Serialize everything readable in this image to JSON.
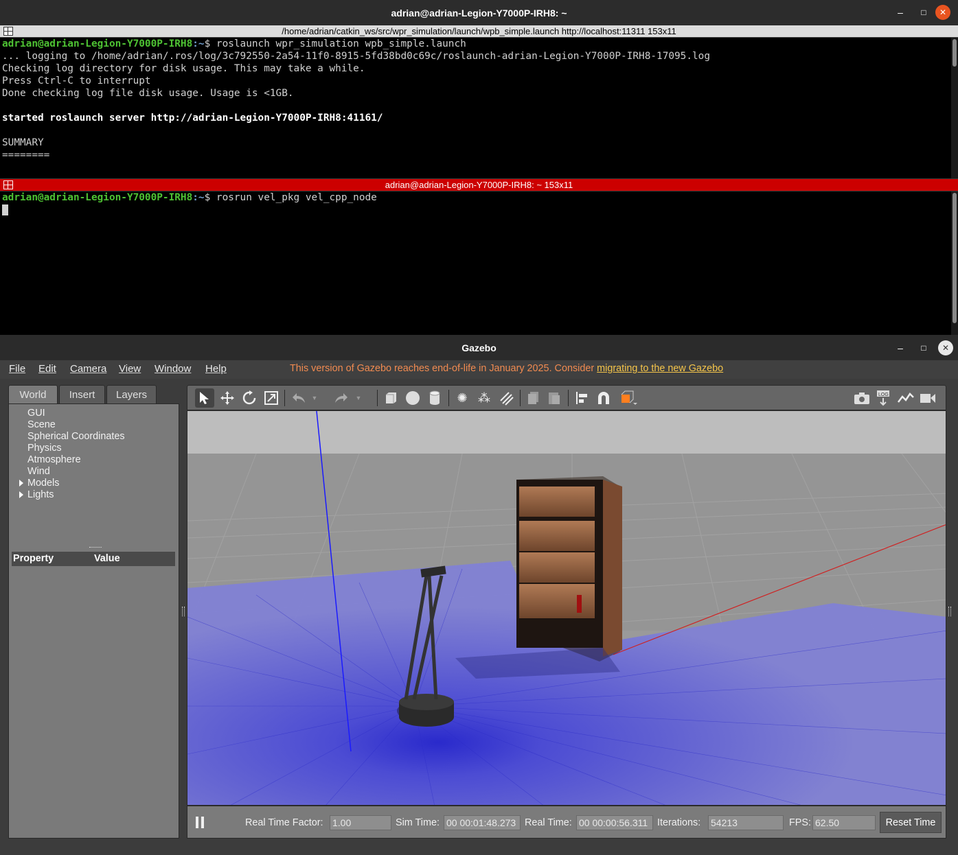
{
  "terminal": {
    "window_title": "adrian@adrian-Legion-Y7000P-IRH8: ~",
    "pane1_title": "/home/adrian/catkin_ws/src/wpr_simulation/launch/wpb_simple.launch http://localhost:11311 153x11",
    "pane2_title": "adrian@adrian-Legion-Y7000P-IRH8: ~ 153x11",
    "prompt_user": "adrian@adrian-Legion-Y7000P-IRH8",
    "prompt_path": ":~",
    "pane1_command": "$ roslaunch wpr_simulation wpb_simple.launch",
    "pane1_lines": [
      "... logging to /home/adrian/.ros/log/3c792550-2a54-11f0-8915-5fd38bd0c69c/roslaunch-adrian-Legion-Y7000P-IRH8-17095.log",
      "Checking log directory for disk usage. This may take a while.",
      "Press Ctrl-C to interrupt",
      "Done checking log file disk usage. Usage is <1GB."
    ],
    "server_line": "started roslaunch server http://adrian-Legion-Y7000P-IRH8:41161/",
    "summary": "SUMMARY",
    "summary_rule": "========",
    "pane2_command": "$ rosrun vel_pkg vel_cpp_node",
    "window_buttons": {
      "min": "–",
      "max": "□",
      "close": "✕"
    }
  },
  "gazebo": {
    "window_title": "Gazebo",
    "menu": [
      "File",
      "Edit",
      "Camera",
      "View",
      "Window",
      "Help"
    ],
    "eol_text": "This version of Gazebo reaches end-of-life in January 2025. Consider ",
    "eol_link": "migrating to the new Gazebo",
    "tabs": [
      "World",
      "Insert",
      "Layers"
    ],
    "world_tree": [
      "GUI",
      "Scene",
      "Spherical Coordinates",
      "Physics",
      "Atmosphere",
      "Wind",
      "Models",
      "Lights"
    ],
    "property_header": "Property",
    "value_header": "Value",
    "bottom": {
      "rtf_label": "Real Time Factor:",
      "rtf_value": "1.00",
      "sim_label": "Sim Time:",
      "sim_value": "00 00:01:48.273",
      "real_label": "Real Time:",
      "real_value": "00 00:00:56.311",
      "iter_label": "Iterations:",
      "iter_value": "54213",
      "fps_label": "FPS:",
      "fps_value": "62.50",
      "reset_label": "Reset Time"
    },
    "toolbar_icons": [
      "select-arrow-icon",
      "translate-icon",
      "rotate-icon",
      "scale-icon",
      "undo-icon",
      "undo-dropdown-icon",
      "redo-icon",
      "redo-dropdown-icon",
      "box-shape-icon",
      "sphere-shape-icon",
      "cylinder-shape-icon",
      "point-light-icon",
      "spot-light-icon",
      "directional-light-icon",
      "copy-icon",
      "paste-icon",
      "align-icon",
      "magnet-snap-icon",
      "view-angle-icon",
      "screenshot-icon",
      "log-icon",
      "plot-icon",
      "record-video-icon"
    ],
    "colors": {
      "laser": "#3b3bd6",
      "eol": "#f08a50",
      "link": "#f5c54a"
    }
  }
}
